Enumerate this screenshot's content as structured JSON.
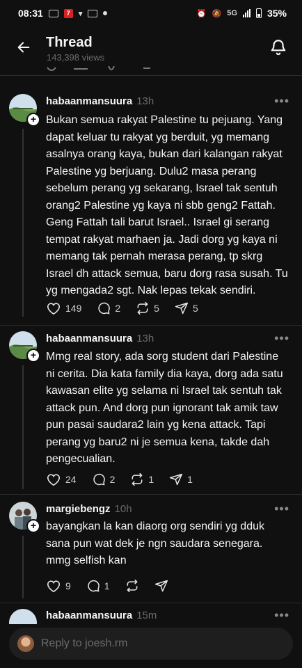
{
  "status_bar": {
    "time": "08:31",
    "battery": "35%",
    "network": "5G"
  },
  "header": {
    "title": "Thread",
    "views": "143,398 views"
  },
  "posts": [
    {
      "username": "habaanmansuura",
      "time": "13h",
      "text": "Bukan semua rakyat Palestine tu pejuang. Yang dapat keluar tu rakyat yg berduit, yg memang asalnya orang kaya, bukan dari kalangan rakyat Palestine yg berjuang. Dulu2 masa perang sebelum perang yg sekarang, Israel tak sentuh orang2 Palestine yg kaya ni sbb geng2 Fattah. Geng Fattah tali barut Israel.. Israel gi serang tempat rakyat marhaen ja. Jadi dorg yg kaya ni memang tak pernah merasa perang, tp skrg Israel dh attack semua, baru dorg rasa susah. Tu yg mengada2 sgt. Nak lepas tekak sendiri.",
      "likes": "149",
      "replies": "2",
      "reposts": "5",
      "shares": "5"
    },
    {
      "username": "habaanmansuura",
      "time": "13h",
      "text": "Mmg real story, ada sorg student dari Palestine ni cerita. Dia kata family dia kaya, dorg ada satu kawasan elite yg selama ni Israel tak sentuh tak attack pun. And dorg pun ignorant tak amik taw pun pasai saudara2 lain yg kena attack. Tapi perang yg baru2 ni je semua kena, takde dah pengecualian.",
      "likes": "24",
      "replies": "2",
      "reposts": "1",
      "shares": "1"
    },
    {
      "username": "margiebengz",
      "time": "10h",
      "text": "bayangkan la kan diaorg org sendiri yg dduk sana pun wat dek je ngn saudara senegara. mmg selfish kan",
      "likes": "9",
      "replies": "1",
      "reposts": "",
      "shares": ""
    },
    {
      "username": "habaanmansuura",
      "time": "15m",
      "text": "",
      "likes": "",
      "replies": "",
      "reposts": "",
      "shares": ""
    }
  ],
  "reply_bar": {
    "placeholder": "Reply to joesh.rm"
  }
}
